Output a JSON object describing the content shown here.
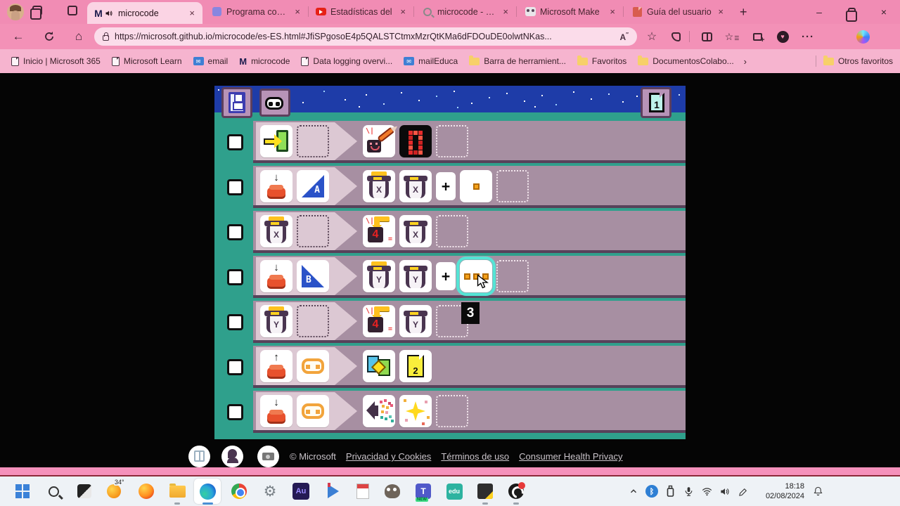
{
  "browser": {
    "tabs": [
      {
        "title": "microcode",
        "active": true,
        "audio_playing": true
      },
      {
        "title": "Programa con M"
      },
      {
        "title": "Estadísticas del"
      },
      {
        "title": "microcode - Bús"
      },
      {
        "title": "Microsoft Make"
      },
      {
        "title": "Guía del usuario"
      }
    ],
    "url": "https://microsoft.github.io/microcode/es-ES.html#JfiSPgosoE4p5QALSTCtmxMzrQtKMa6dFDOuDE0olwtNKas...",
    "bookmarks": [
      "Inicio | Microsoft 365",
      "Microsoft Learn",
      "email",
      "microcode",
      "Data logging overvi...",
      "mailEduca",
      "Barra de herramient...",
      "Favoritos",
      "DocumentosColabo...",
      "Otros favoritos"
    ]
  },
  "editor": {
    "page": {
      "current": "1",
      "target": "2"
    },
    "tooltip": "3",
    "labels": {
      "a": "A",
      "b": "B",
      "x": "X",
      "y": "Y",
      "four": "4"
    },
    "rules": [
      {
        "when": [
          "start-event"
        ],
        "do": [
          "paint-screen",
          "led-display-0"
        ]
      },
      {
        "when": [
          "button-press",
          "button-a"
        ],
        "do": [
          "pour-into-cup-x",
          "cup-x",
          "plus",
          "value-1"
        ]
      },
      {
        "when": [
          "cup-x-changed"
        ],
        "do": [
          "show-number",
          "cup-x"
        ]
      },
      {
        "when": [
          "button-press",
          "button-b"
        ],
        "do": [
          "pour-into-cup-y",
          "cup-y",
          "plus",
          "value-3-selected"
        ]
      },
      {
        "when": [
          "cup-y-changed"
        ],
        "do": [
          "show-number",
          "cup-y"
        ]
      },
      {
        "when": [
          "button-release",
          "logo-face"
        ],
        "do": [
          "switch-page",
          "page-2"
        ]
      },
      {
        "when": [
          "button-press",
          "logo-face"
        ],
        "do": [
          "play-sound-emoji",
          "sparkle-effect"
        ]
      }
    ],
    "colors": {
      "teal_bg": "#2fa08c",
      "row_purple": "#a78fa2",
      "sky_blue": "#1e3ca8",
      "selection_teal": "#55e4d5",
      "when_strip": "#dcc8d3"
    }
  },
  "footer": {
    "copyright": "© Microsoft",
    "links": [
      "Privacidad y Cookies",
      "Términos de uso",
      "Consumer Health Privacy"
    ]
  },
  "taskbar": {
    "weather": "34°",
    "audition": "Au",
    "teams_badge": "NEW",
    "edu": "edu",
    "time": "18:18",
    "date": "02/08/2024"
  },
  "theme": {
    "browser_pink": "#f18cb4",
    "active_tab_pink": "#fbd4e4",
    "bookmarks_pink": "#f6b4cf"
  }
}
